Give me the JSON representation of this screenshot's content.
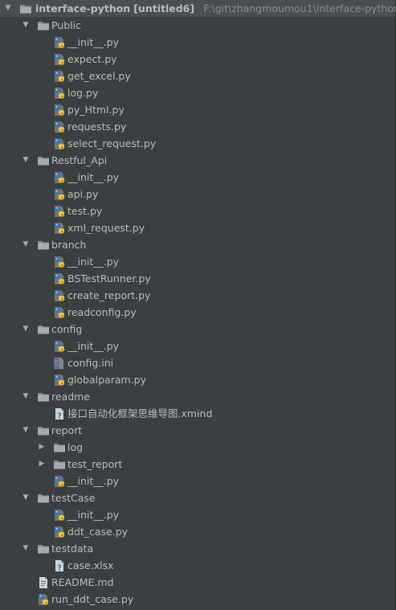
{
  "project_tree": {
    "root": {
      "name": "interface-python",
      "module": "[untitled6]",
      "path": "F:\\git\\zhangmoumou1\\interface-python"
    },
    "items": [
      {
        "label": "Public",
        "depth": 1,
        "type": "folder",
        "expanded": true
      },
      {
        "label": "__init__.py",
        "depth": 2,
        "type": "python"
      },
      {
        "label": "expect.py",
        "depth": 2,
        "type": "python"
      },
      {
        "label": "get_excel.py",
        "depth": 2,
        "type": "python"
      },
      {
        "label": "log.py",
        "depth": 2,
        "type": "python"
      },
      {
        "label": "py_Html.py",
        "depth": 2,
        "type": "python"
      },
      {
        "label": "requests.py",
        "depth": 2,
        "type": "python"
      },
      {
        "label": "select_request.py",
        "depth": 2,
        "type": "python"
      },
      {
        "label": "Restful_Api",
        "depth": 1,
        "type": "folder",
        "expanded": true
      },
      {
        "label": "__init__.py",
        "depth": 2,
        "type": "python"
      },
      {
        "label": "api.py",
        "depth": 2,
        "type": "python"
      },
      {
        "label": "test.py",
        "depth": 2,
        "type": "python"
      },
      {
        "label": "xml_request.py",
        "depth": 2,
        "type": "python"
      },
      {
        "label": "branch",
        "depth": 1,
        "type": "folder",
        "expanded": true
      },
      {
        "label": "__init__.py",
        "depth": 2,
        "type": "python"
      },
      {
        "label": "BSTestRunner.py",
        "depth": 2,
        "type": "python"
      },
      {
        "label": "create_report.py",
        "depth": 2,
        "type": "python"
      },
      {
        "label": "readconfig.py",
        "depth": 2,
        "type": "python"
      },
      {
        "label": "config",
        "depth": 1,
        "type": "folder",
        "expanded": true
      },
      {
        "label": "__init__.py",
        "depth": 2,
        "type": "python"
      },
      {
        "label": "config.ini",
        "depth": 2,
        "type": "ini"
      },
      {
        "label": "globalparam.py",
        "depth": 2,
        "type": "python"
      },
      {
        "label": "readme",
        "depth": 1,
        "type": "folder",
        "expanded": true
      },
      {
        "label": "接口自动化框架思维导图.xmind",
        "depth": 2,
        "type": "unknown"
      },
      {
        "label": "report",
        "depth": 1,
        "type": "folder",
        "expanded": true
      },
      {
        "label": "log",
        "depth": 2,
        "type": "folder",
        "expanded": false
      },
      {
        "label": "test_report",
        "depth": 2,
        "type": "folder",
        "expanded": false
      },
      {
        "label": "__init__.py",
        "depth": 2,
        "type": "python"
      },
      {
        "label": "testCase",
        "depth": 1,
        "type": "folder",
        "expanded": true
      },
      {
        "label": "__init__.py",
        "depth": 2,
        "type": "python"
      },
      {
        "label": "ddt_case.py",
        "depth": 2,
        "type": "python"
      },
      {
        "label": "testdata",
        "depth": 1,
        "type": "folder",
        "expanded": true
      },
      {
        "label": "case.xlsx",
        "depth": 2,
        "type": "unknown"
      },
      {
        "label": "README.md",
        "depth": 1,
        "type": "text"
      },
      {
        "label": "run_ddt_case.py",
        "depth": 1,
        "type": "python"
      }
    ],
    "icon_names": {
      "folder": "folder-icon",
      "python": "python-file-icon",
      "ini": "ini-file-icon",
      "unknown": "unknown-file-icon",
      "text": "text-file-icon"
    },
    "colors": {
      "background": "#3c3f41",
      "text": "#bbbbbb",
      "path_text": "#8c8c8c",
      "arrow": "#a9a9a9"
    }
  }
}
